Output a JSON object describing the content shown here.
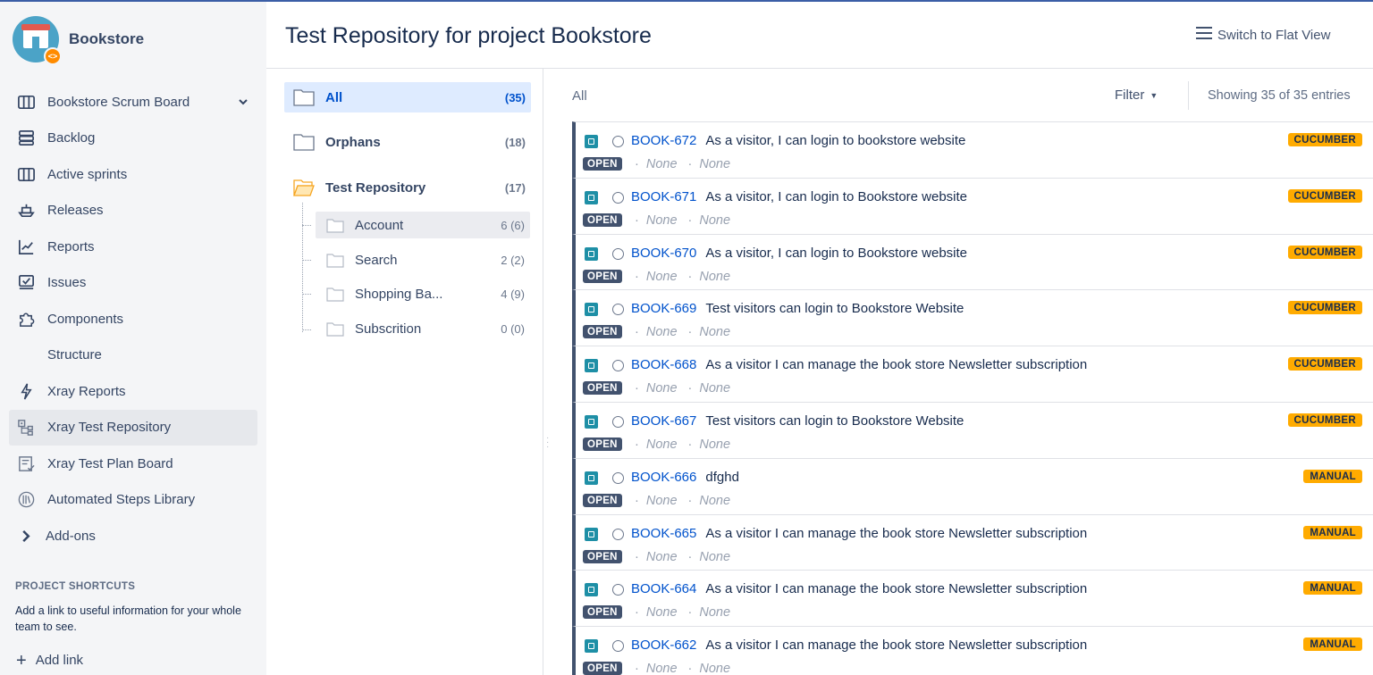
{
  "project": {
    "name": "Bookstore",
    "badge": "<>"
  },
  "sidebar": {
    "board": "Bookstore Scrum Board",
    "items": [
      {
        "label": "Backlog",
        "icon": "backlog-icon"
      },
      {
        "label": "Active sprints",
        "icon": "board-columns-icon"
      },
      {
        "label": "Releases",
        "icon": "ship-icon"
      },
      {
        "label": "Reports",
        "icon": "chart-icon"
      },
      {
        "label": "Issues",
        "icon": "issues-icon"
      },
      {
        "label": "Components",
        "icon": "puzzle-icon"
      },
      {
        "label": "Structure",
        "icon": ""
      },
      {
        "label": "Xray Reports",
        "icon": "bolt-icon"
      },
      {
        "label": "Xray Test Repository",
        "icon": "repository-icon"
      },
      {
        "label": "Xray Test Plan Board",
        "icon": "plan-board-icon"
      },
      {
        "label": "Automated Steps Library",
        "icon": "library-icon"
      }
    ],
    "addons": "Add-ons",
    "shortcuts_title": "PROJECT SHORTCUTS",
    "shortcuts_text": "Add a link to useful information for your whole team to see.",
    "add_link": "Add link"
  },
  "header": {
    "title": "Test Repository for project Bookstore",
    "switch_view": "Switch to Flat View"
  },
  "tree": {
    "all": {
      "label": "All",
      "count": "(35)"
    },
    "orphans": {
      "label": "Orphans",
      "count": "(18)"
    },
    "repo": {
      "label": "Test Repository",
      "count": "(17)"
    },
    "children": [
      {
        "label": "Account",
        "count": "6 (6)"
      },
      {
        "label": "Search",
        "count": "2 (2)"
      },
      {
        "label": "Shopping Ba...",
        "count": "4 (9)"
      },
      {
        "label": "Subscrition",
        "count": "0 (0)"
      }
    ]
  },
  "list": {
    "crumb": "All",
    "filter": "Filter",
    "showing": "Showing 35 of 35 entries",
    "status": "OPEN",
    "none": "None",
    "rows": [
      {
        "key": "BOOK-672",
        "summary": "As a visitor, I can login to bookstore website",
        "tag": "CUCUMBER"
      },
      {
        "key": "BOOK-671",
        "summary": "As a visitor, I can login to Bookstore website",
        "tag": "CUCUMBER"
      },
      {
        "key": "BOOK-670",
        "summary": "As a visitor, I can login to Bookstore website",
        "tag": "CUCUMBER"
      },
      {
        "key": "BOOK-669",
        "summary": "Test visitors can login to Bookstore Website",
        "tag": "CUCUMBER"
      },
      {
        "key": "BOOK-668",
        "summary": "As a visitor I can manage the book store Newsletter subscription",
        "tag": "CUCUMBER"
      },
      {
        "key": "BOOK-667",
        "summary": "Test visitors can login to Bookstore Website",
        "tag": "CUCUMBER"
      },
      {
        "key": "BOOK-666",
        "summary": "dfghd",
        "tag": "MANUAL"
      },
      {
        "key": "BOOK-665",
        "summary": "As a visitor I can manage the book store Newsletter subscription",
        "tag": "MANUAL"
      },
      {
        "key": "BOOK-664",
        "summary": "As a visitor I can manage the book store Newsletter subscription",
        "tag": "MANUAL"
      },
      {
        "key": "BOOK-662",
        "summary": "As a visitor I can manage the book store Newsletter subscription",
        "tag": "MANUAL"
      }
    ]
  }
}
